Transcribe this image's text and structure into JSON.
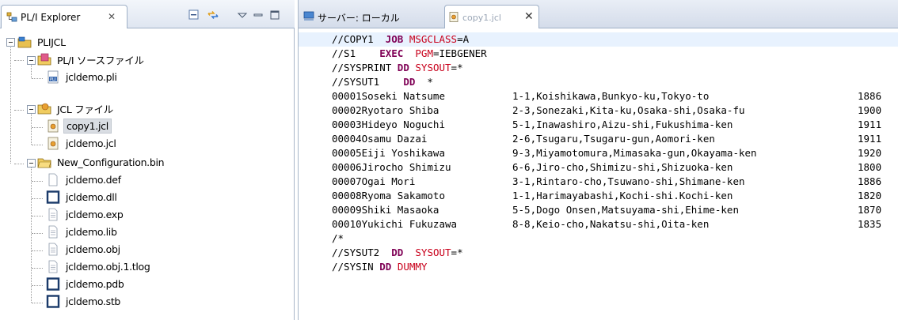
{
  "explorer": {
    "title": "PL/I Explorer",
    "close": "✕",
    "tree": [
      {
        "label": "PLIJCL",
        "icon": "project-icon",
        "level": 0,
        "expanded": true
      },
      {
        "label": "PL/I ソースファイル",
        "icon": "pli-folder-icon",
        "level": 1,
        "expanded": true
      },
      {
        "label": "jcldemo.pli",
        "icon": "pli-file-icon",
        "level": 2
      },
      {
        "label": "JCL ファイル",
        "icon": "jcl-folder-icon",
        "level": 1,
        "expanded": true
      },
      {
        "label": "copy1.jcl",
        "icon": "jcl-file-icon",
        "level": 2,
        "selected": true
      },
      {
        "label": "jcldemo.jcl",
        "icon": "jcl-file-icon",
        "level": 2
      },
      {
        "label": "New_Configuration.bin",
        "icon": "folder-icon",
        "level": 1,
        "expanded": true
      },
      {
        "label": "jcldemo.def",
        "icon": "file-icon",
        "level": 2
      },
      {
        "label": "jcldemo.dll",
        "icon": "binary-file-icon",
        "level": 2
      },
      {
        "label": "jcldemo.exp",
        "icon": "text-file-icon",
        "level": 2
      },
      {
        "label": "jcldemo.lib",
        "icon": "text-file-icon",
        "level": 2
      },
      {
        "label": "jcldemo.obj",
        "icon": "text-file-icon",
        "level": 2
      },
      {
        "label": "jcldemo.obj.1.tlog",
        "icon": "text-file-icon",
        "level": 2
      },
      {
        "label": "jcldemo.pdb",
        "icon": "binary-file-icon",
        "level": 2
      },
      {
        "label": "jcldemo.stb",
        "icon": "binary-file-icon",
        "level": 2
      }
    ]
  },
  "editor": {
    "tabs": [
      {
        "title": "サーバー: ローカル",
        "icon": "server-icon",
        "active": false
      },
      {
        "title": "copy1.jcl",
        "icon": "jcl-file-icon",
        "active": true,
        "close": "✕"
      }
    ],
    "jcl_lines": [
      [
        "//COPY1  ",
        "JOB",
        " ",
        "MSGCLASS",
        "=A"
      ],
      [
        "//S1    ",
        "EXEC",
        "  ",
        "PGM",
        "=IEBGENER"
      ],
      [
        "//SYSPRINT ",
        "DD",
        " ",
        "SYSOUT",
        "=*"
      ],
      [
        "//SYSUT1    ",
        "DD",
        "  *",
        "",
        ""
      ]
    ],
    "data_rows": [
      [
        "00001Soseki Natsume",
        "1-1,Koishikawa,Bunkyo-ku,Tokyo-to",
        "1886"
      ],
      [
        "00002Ryotaro Shiba",
        "2-3,Sonezaki,Kita-ku,Osaka-shi,Osaka-fu",
        "1900"
      ],
      [
        "00003Hideyo Noguchi",
        "5-1,Inawashiro,Aizu-shi,Fukushima-ken",
        "1911"
      ],
      [
        "00004Osamu Dazai",
        "2-6,Tsugaru,Tsugaru-gun,Aomori-ken",
        "1911"
      ],
      [
        "00005Eiji Yoshikawa",
        "9-3,Miyamotomura,Mimasaka-gun,Okayama-ken",
        "1920"
      ],
      [
        "00006Jirocho Shimizu",
        "6-6,Jiro-cho,Shimizu-shi,Shizuoka-ken",
        "1800"
      ],
      [
        "00007Ogai Mori",
        "3-1,Rintaro-cho,Tsuwano-shi,Shimane-ken",
        "1886"
      ],
      [
        "00008Ryoma Sakamoto",
        "1-1,Harimayabashi,Kochi-shi.Kochi-ken",
        "1820"
      ],
      [
        "00009Shiki Masaoka",
        "5-5,Dogo Onsen,Matsuyama-shi,Ehime-ken",
        "1870"
      ],
      [
        "00010Yukichi Fukuzawa",
        "8-8,Keio-cho,Nakatsu-shi,Oita-ken",
        "1835"
      ]
    ],
    "end_line": "/*",
    "tail_lines": [
      [
        "//SYSUT2  ",
        "DD",
        "  ",
        "SYSOUT",
        "=*"
      ],
      [
        "//SYSIN ",
        "DD",
        " ",
        "DUMMY",
        ""
      ]
    ]
  },
  "colors": {
    "keyword": "#7f0055",
    "parameter": "#c8001b",
    "current_line": "#e8f2fe",
    "selection": "#d9dde3"
  }
}
